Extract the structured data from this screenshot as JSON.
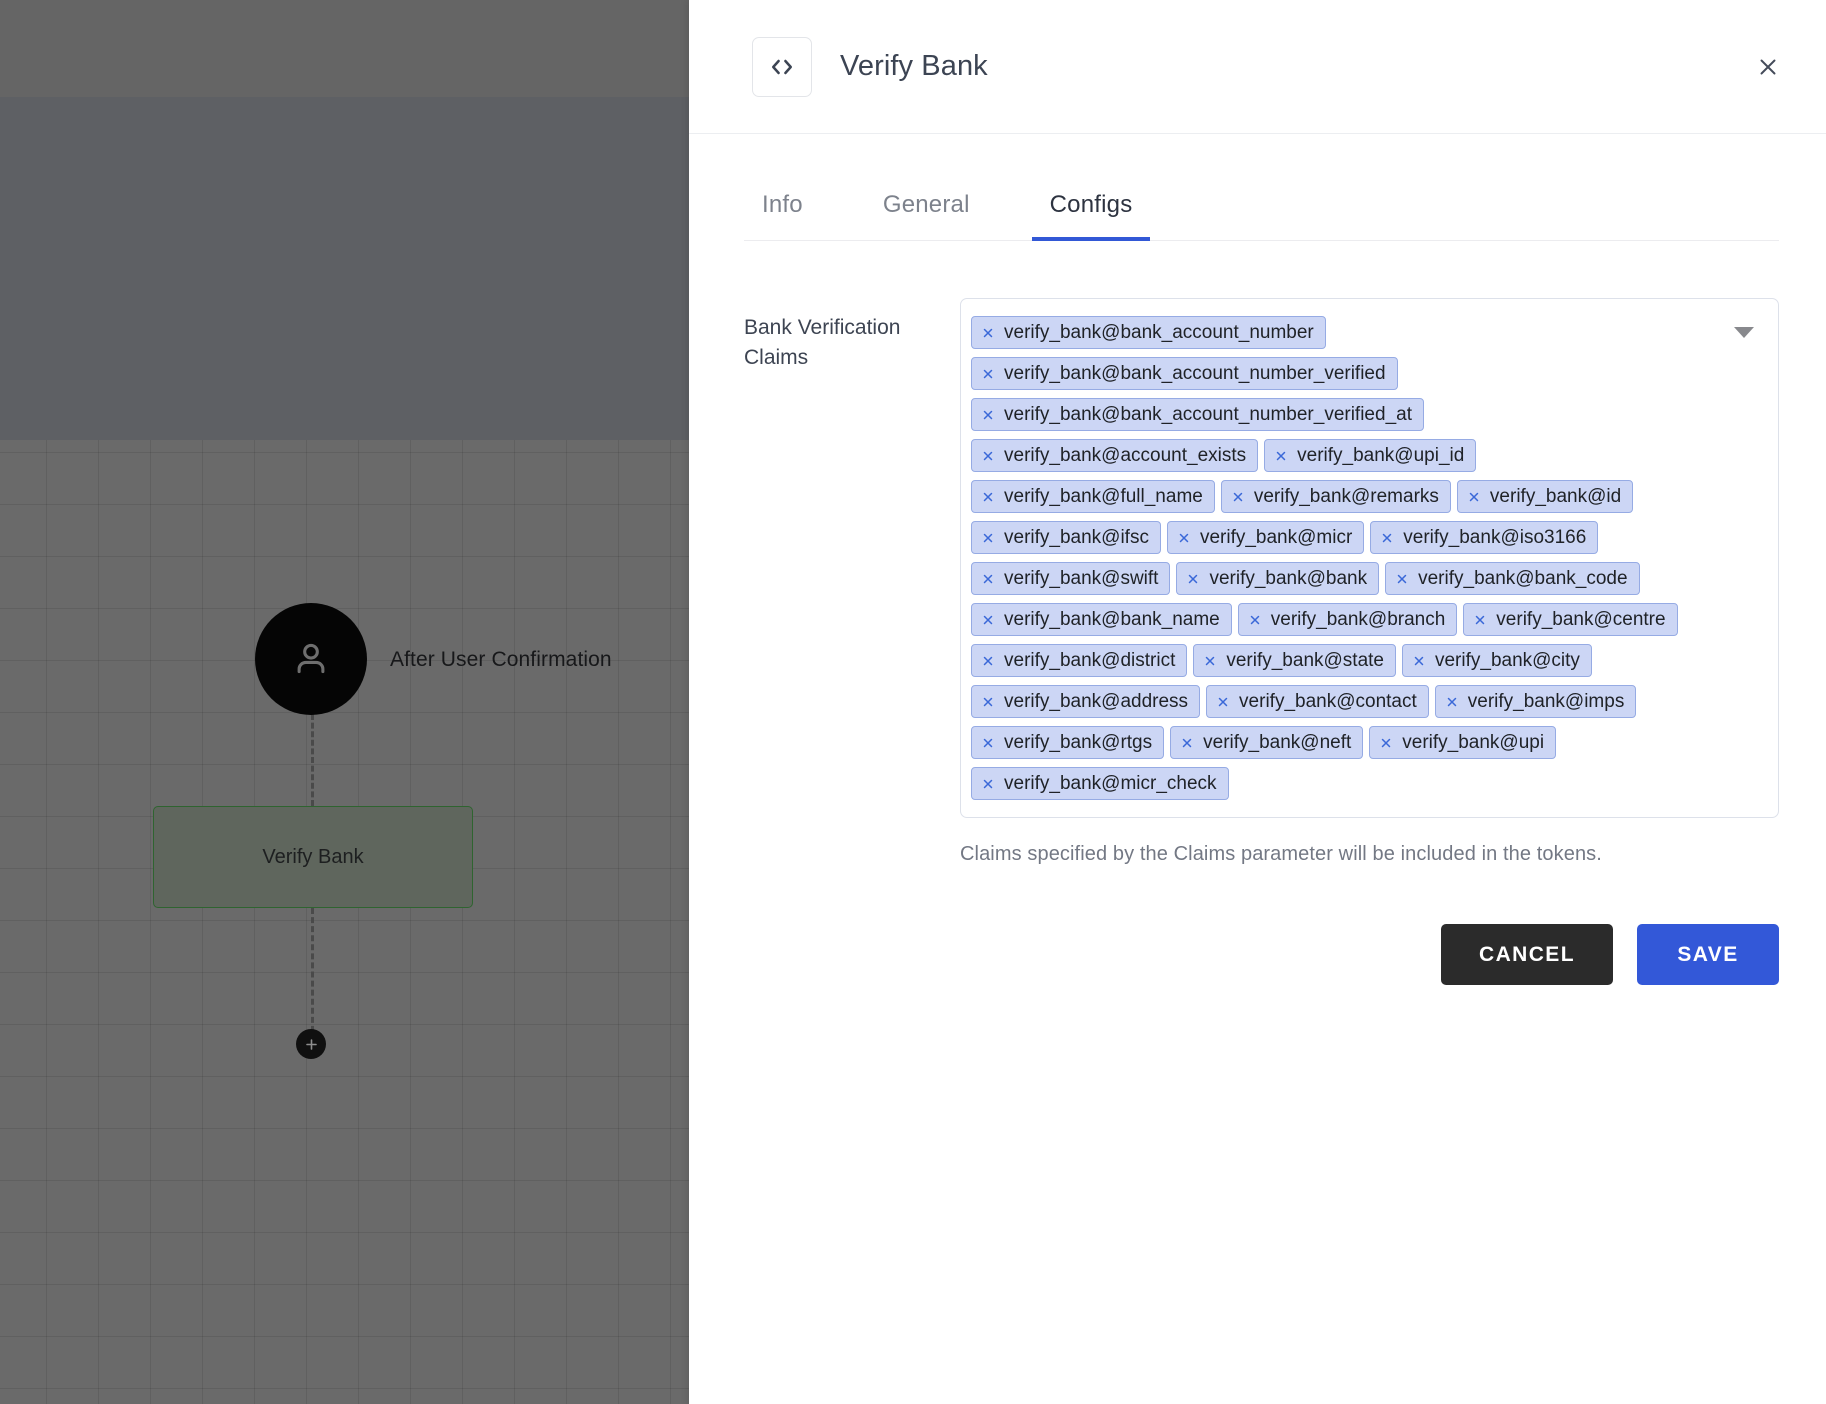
{
  "canvas": {
    "user_node_icon": "person-icon",
    "user_node_label": "After User Confirmation",
    "task_node_label": "Verify Bank",
    "add_node_icon": "plus-icon"
  },
  "panel": {
    "icon": "code-brackets-icon",
    "title": "Verify Bank",
    "close_icon": "close-icon",
    "tabs": [
      {
        "label": "Info",
        "active": false
      },
      {
        "label": "General",
        "active": false
      },
      {
        "label": "Configs",
        "active": true
      }
    ]
  },
  "form": {
    "field_label": "Bank Verification Claims",
    "dropdown_icon": "chevron-down-icon",
    "chip_remove_icon": "close-small-icon",
    "helper_text": "Claims specified by the Claims parameter will be included in the tokens.",
    "chips": [
      "verify_bank@bank_account_number",
      "verify_bank@bank_account_number_verified",
      "verify_bank@bank_account_number_verified_at",
      "verify_bank@account_exists",
      "verify_bank@upi_id",
      "verify_bank@full_name",
      "verify_bank@remarks",
      "verify_bank@id",
      "verify_bank@ifsc",
      "verify_bank@micr",
      "verify_bank@iso3166",
      "verify_bank@swift",
      "verify_bank@bank",
      "verify_bank@bank_code",
      "verify_bank@bank_name",
      "verify_bank@branch",
      "verify_bank@centre",
      "verify_bank@district",
      "verify_bank@state",
      "verify_bank@city",
      "verify_bank@address",
      "verify_bank@contact",
      "verify_bank@imps",
      "verify_bank@rtgs",
      "verify_bank@neft",
      "verify_bank@upi",
      "verify_bank@micr_check"
    ]
  },
  "actions": {
    "cancel_label": "CANCEL",
    "save_label": "SAVE"
  },
  "colors": {
    "accent_blue": "#3358d8",
    "chip_bg": "#ccd6f5",
    "chip_border": "#96abe4",
    "chip_x": "#3a68d8",
    "cancel_bg": "#2b2b2b",
    "node_border_green": "#2f6430",
    "node_bg": "#5f665d"
  }
}
